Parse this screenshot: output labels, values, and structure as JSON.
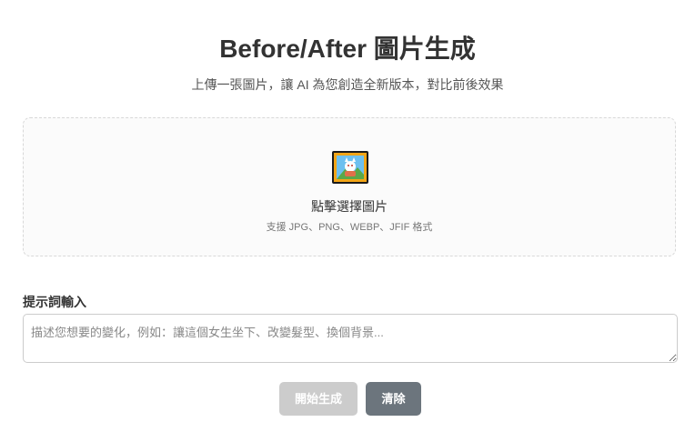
{
  "header": {
    "title": "Before/After 圖片生成",
    "subtitle": "上傳一張圖片，讓 AI 為您創造全新版本，對比前後效果"
  },
  "upload": {
    "icon": "framed-picture-icon",
    "label": "點擊選擇圖片",
    "hint": "支援 JPG、PNG、WEBP、JFIF 格式"
  },
  "prompt": {
    "label": "提示詞輸入",
    "placeholder": "描述您想要的變化，例如：讓這個女生坐下、改變髮型、換個背景...",
    "value": ""
  },
  "actions": {
    "start_label": "開始生成",
    "start_disabled": true,
    "clear_label": "清除"
  },
  "colors": {
    "start_button_bg": "#cccccc",
    "clear_button_bg": "#6c757d",
    "upload_border": "#d8d8d8"
  }
}
